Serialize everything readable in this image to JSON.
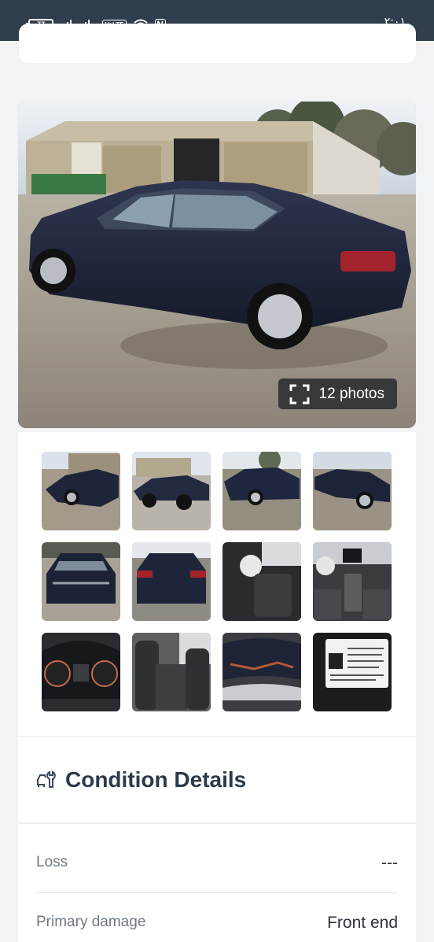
{
  "status_bar": {
    "battery": "77",
    "sim2_label": "2",
    "volte": "VoLTE",
    "nfc": "N",
    "time": "۲:۰۱"
  },
  "hero": {
    "photos_count_label": "12 photos",
    "expand_icon": "expand-icon"
  },
  "thumbnails": [
    {
      "label": "front-left damaged view"
    },
    {
      "label": "left side view"
    },
    {
      "label": "rear-left view"
    },
    {
      "label": "front-right damaged view"
    },
    {
      "label": "front damage view"
    },
    {
      "label": "rear view"
    },
    {
      "label": "driver interior view"
    },
    {
      "label": "dashboard interior view"
    },
    {
      "label": "instrument cluster"
    },
    {
      "label": "rear seats"
    },
    {
      "label": "hood damage closeup"
    },
    {
      "label": "VIN label"
    }
  ],
  "condition": {
    "title": "Condition Details",
    "icon": "car-wrench-icon",
    "rows": [
      {
        "label": "Loss",
        "value": "---"
      },
      {
        "label": "Primary damage",
        "value": "Front end"
      }
    ]
  },
  "colors": {
    "status_bar_bg": "#2f3d4d",
    "title_text": "#2c3a4a",
    "page_bg": "#f2f3f5"
  }
}
